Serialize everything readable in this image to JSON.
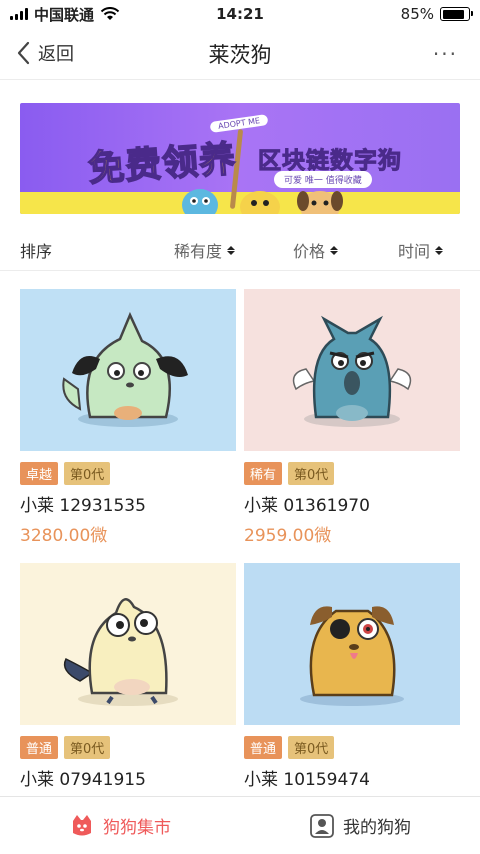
{
  "status_bar": {
    "carrier": "中国联通",
    "time": "14:21",
    "battery": "85%",
    "battery_level": 0.85
  },
  "nav": {
    "back_label": "返回",
    "title": "莱茨狗",
    "more_label": "···"
  },
  "banner": {
    "title": "免费领养",
    "subtitle": "区块链数字狗",
    "tagline": "可爱 唯一 值得收藏",
    "sign": "ADOPT ME"
  },
  "sort": {
    "label": "排序",
    "options": [
      "稀有度",
      "价格",
      "时间"
    ]
  },
  "pets": [
    {
      "rarity": "卓越",
      "generation": "第0代",
      "name": "小莱 12931535",
      "price": "3280.00微",
      "bg": "#bfe0f5"
    },
    {
      "rarity": "稀有",
      "generation": "第0代",
      "name": "小莱 01361970",
      "price": "2959.00微",
      "bg": "#f6e1de"
    },
    {
      "rarity": "普通",
      "generation": "第0代",
      "name": "小莱 07941915",
      "price": "",
      "bg": "#fbf3dc"
    },
    {
      "rarity": "普通",
      "generation": "第0代",
      "name": "小莱 10159474",
      "price": "",
      "bg": "#bcdcf3"
    }
  ],
  "tabbar": {
    "market": "狗狗集市",
    "mine": "我的狗狗"
  }
}
